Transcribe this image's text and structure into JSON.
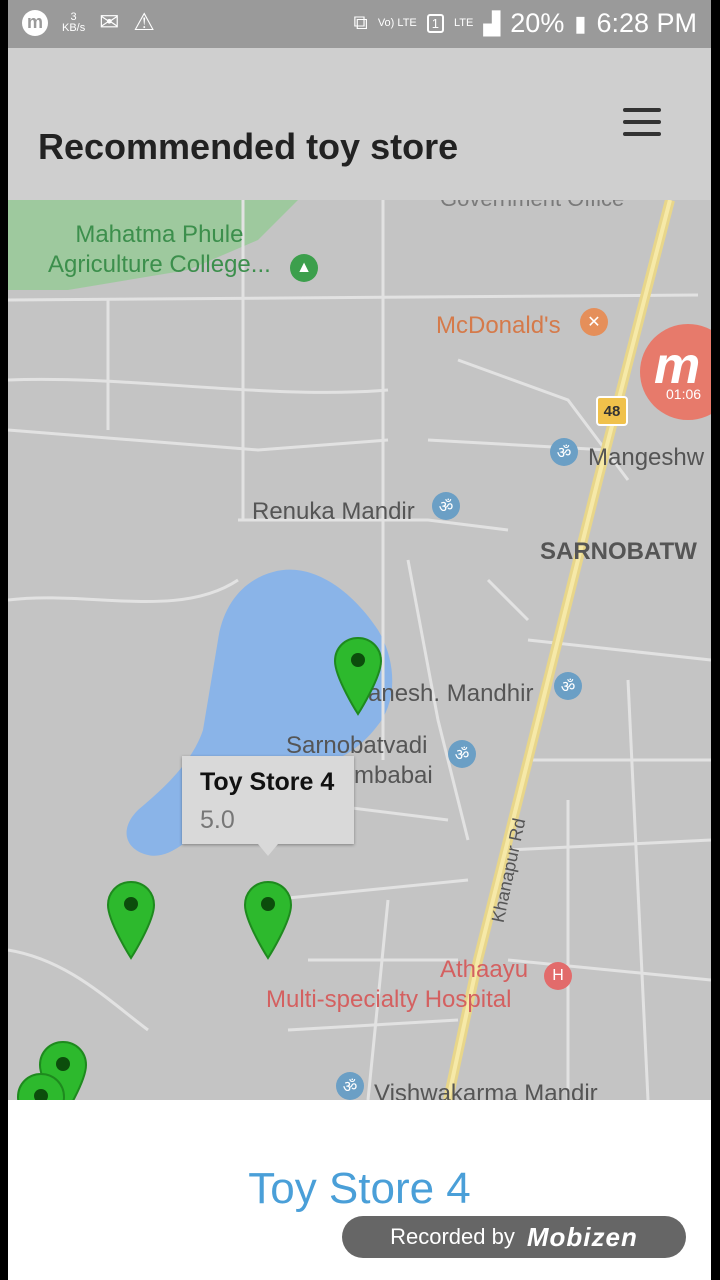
{
  "status_bar": {
    "net_speed_value": "3",
    "net_speed_unit": "KB/s",
    "volte": "Vo) LTE",
    "sim": "1",
    "lte": "LTE",
    "battery": "20%",
    "time": "6:28 PM"
  },
  "app_bar": {
    "title": "Recommended toy store",
    "menu_icon": "hamburger-menu-icon"
  },
  "map": {
    "labels": {
      "college": "Mahatma Phule\nAgriculture College...",
      "mcdonalds": "McDonald's",
      "mangeshwar": "Mangeshw",
      "renuka": "Renuka Mandir",
      "sarnobatwadi_area": "SARNOBATW",
      "ganesh": "anesh. Mandhir",
      "sarnobatvadi": "Sarnobatvadi",
      "ambabai": "mbabai",
      "road": "Khanapur Rd",
      "hospital_1": "Athaayu",
      "hospital_2": "Multi-specialty Hospital",
      "vishwakarma": "Vishwakarma Mandir",
      "government": "Government Office",
      "highway": "48",
      "recording_time": "01:06",
      "recording_logo": "m"
    },
    "colors": {
      "marker": "#2db92d",
      "water": "#8ab4e8",
      "park": "#8fcc8f",
      "road_major": "#e8d68a"
    },
    "info_window": {
      "title": "Toy Store 4",
      "rating": "5.0"
    }
  },
  "panel": {
    "selected_store": "Toy Store 4"
  },
  "recording_badge": {
    "text": "Recorded by",
    "brand": "Mobizen"
  }
}
